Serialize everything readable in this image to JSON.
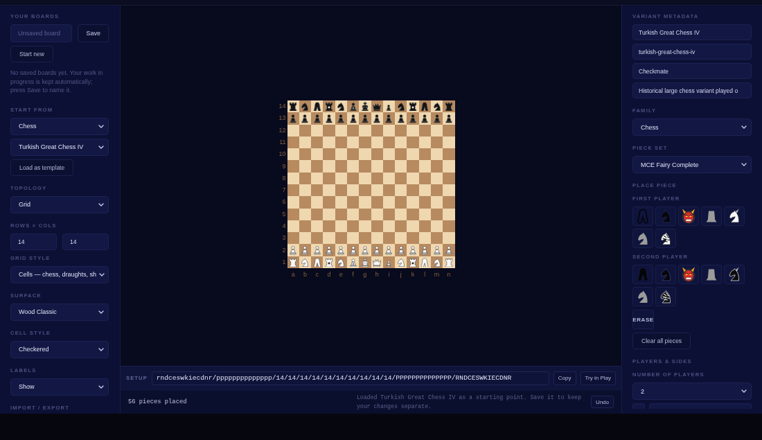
{
  "left_panel": {
    "sections": [
      {
        "heading": "YOUR BOARDS",
        "controls": [
          {
            "kind": "input_button_row",
            "placeholder": "Unsaved board",
            "button": "Save"
          },
          {
            "kind": "button",
            "label": "Start new"
          },
          {
            "kind": "note",
            "text": "No saved boards yet. Your work in progress is kept automatically; press Save to name it."
          }
        ]
      },
      {
        "heading": "START FROM",
        "controls": [
          {
            "kind": "select",
            "value": "Chess"
          },
          {
            "kind": "select",
            "value": "Turkish Great Chess IV"
          },
          {
            "kind": "button",
            "label": "Load as template"
          }
        ]
      },
      {
        "heading": "TOPOLOGY",
        "controls": [
          {
            "kind": "select",
            "value": "Grid"
          }
        ]
      },
      {
        "heading": "ROWS × COLS",
        "controls": [
          {
            "kind": "number_pair",
            "values": [
              "14",
              "14"
            ]
          }
        ]
      },
      {
        "heading": "GRID STYLE",
        "controls": [
          {
            "kind": "select",
            "value": "Cells — chess, draughts, sh"
          }
        ]
      },
      {
        "heading": "SURFACE",
        "controls": [
          {
            "kind": "select",
            "value": "Wood Classic"
          }
        ]
      },
      {
        "heading": "CELL STYLE",
        "controls": [
          {
            "kind": "select",
            "value": "Checkered"
          }
        ]
      },
      {
        "heading": "LABELS",
        "controls": [
          {
            "kind": "select",
            "value": "Show"
          }
        ]
      },
      {
        "heading": "IMPORT / EXPORT"
      }
    ]
  },
  "board": {
    "files": [
      "a",
      "b",
      "c",
      "d",
      "e",
      "f",
      "g",
      "h",
      "i",
      "j",
      "k",
      "l",
      "m",
      "n"
    ],
    "rows": [
      {
        "rank": "14",
        "black_pieces": true,
        "cells": [
          {
            "kind": "rook"
          },
          {
            "kind": "knight"
          },
          {
            "kind": "twin"
          },
          {
            "kind": "badgedrook"
          },
          {
            "kind": "knight"
          },
          {
            "kind": "badgedpawn"
          },
          {
            "kind": "king"
          },
          {
            "kind": "crown"
          },
          {
            "kind": "smallpawn"
          },
          {
            "kind": "knight"
          },
          {
            "kind": "badgedrook"
          },
          {
            "kind": "twin"
          },
          {
            "kind": "knight"
          },
          {
            "kind": "rook"
          }
        ]
      },
      {
        "rank": "13",
        "black_pieces": true,
        "cells": [
          {
            "kind": "pawn"
          },
          {
            "kind": "pawn"
          },
          {
            "kind": "pawn"
          },
          {
            "kind": "pawn"
          },
          {
            "kind": "pawn"
          },
          {
            "kind": "pawn"
          },
          {
            "kind": "pawn"
          },
          {
            "kind": "pawn"
          },
          {
            "kind": "pawn"
          },
          {
            "kind": "pawn"
          },
          {
            "kind": "pawn"
          },
          {
            "kind": "pawn"
          },
          {
            "kind": "pawn"
          },
          {
            "kind": "pawn"
          }
        ]
      },
      {
        "rank": "12",
        "cells": [
          null,
          null,
          null,
          null,
          null,
          null,
          null,
          null,
          null,
          null,
          null,
          null,
          null,
          null
        ]
      },
      {
        "rank": "11",
        "cells": [
          null,
          null,
          null,
          null,
          null,
          null,
          null,
          null,
          null,
          null,
          null,
          null,
          null,
          null
        ]
      },
      {
        "rank": "10",
        "cells": [
          null,
          null,
          null,
          null,
          null,
          null,
          null,
          null,
          null,
          null,
          null,
          null,
          null,
          null
        ]
      },
      {
        "rank": "9",
        "cells": [
          null,
          null,
          null,
          null,
          null,
          null,
          null,
          null,
          null,
          null,
          null,
          null,
          null,
          null
        ]
      },
      {
        "rank": "8",
        "cells": [
          null,
          null,
          null,
          null,
          null,
          null,
          null,
          null,
          null,
          null,
          null,
          null,
          null,
          null
        ]
      },
      {
        "rank": "7",
        "cells": [
          null,
          null,
          null,
          null,
          null,
          null,
          null,
          null,
          null,
          null,
          null,
          null,
          null,
          null
        ]
      },
      {
        "rank": "6",
        "cells": [
          null,
          null,
          null,
          null,
          null,
          null,
          null,
          null,
          null,
          null,
          null,
          null,
          null,
          null
        ]
      },
      {
        "rank": "5",
        "cells": [
          null,
          null,
          null,
          null,
          null,
          null,
          null,
          null,
          null,
          null,
          null,
          null,
          null,
          null
        ]
      },
      {
        "rank": "4",
        "cells": [
          null,
          null,
          null,
          null,
          null,
          null,
          null,
          null,
          null,
          null,
          null,
          null,
          null,
          null
        ]
      },
      {
        "rank": "3",
        "cells": [
          null,
          null,
          null,
          null,
          null,
          null,
          null,
          null,
          null,
          null,
          null,
          null,
          null,
          null
        ]
      },
      {
        "rank": "2",
        "black_pieces": false,
        "cells": [
          {
            "kind": "pawn"
          },
          {
            "kind": "pawn"
          },
          {
            "kind": "pawn"
          },
          {
            "kind": "pawn"
          },
          {
            "kind": "pawn"
          },
          {
            "kind": "pawn"
          },
          {
            "kind": "pawn"
          },
          {
            "kind": "pawn"
          },
          {
            "kind": "pawn"
          },
          {
            "kind": "pawn"
          },
          {
            "kind": "pawn"
          },
          {
            "kind": "pawn"
          },
          {
            "kind": "pawn"
          },
          {
            "kind": "pawn"
          }
        ]
      },
      {
        "rank": "1",
        "black_pieces": false,
        "cells": [
          {
            "kind": "rook"
          },
          {
            "kind": "knight"
          },
          {
            "kind": "twin"
          },
          {
            "kind": "badgedrook"
          },
          {
            "kind": "knight"
          },
          {
            "kind": "badgedpawn"
          },
          {
            "kind": "king"
          },
          {
            "kind": "crown"
          },
          {
            "kind": "smallpawn"
          },
          {
            "kind": "knight"
          },
          {
            "kind": "badgedrook"
          },
          {
            "kind": "twin"
          },
          {
            "kind": "knight"
          },
          {
            "kind": "rook"
          }
        ]
      }
    ]
  },
  "setup_bar": {
    "label": "SETUP",
    "value": "rndceswkiecdnr/pppppppppppppp/14/14/14/14/14/14/14/14/14/14/PPPPPPPPPPPPPP/RNDCESWKIECDNR",
    "buttons": [
      "Copy",
      "Try in Play"
    ]
  },
  "status_bar": {
    "count": "56 pieces placed",
    "message": "Loaded Turkish Great Chess IV as a starting point. Save it to keep your changes separate.",
    "button": "Undo"
  },
  "right_panel": {
    "sections": [
      {
        "heading": "VARIANT METADATA",
        "controls": [
          {
            "kind": "input",
            "value": "Turkish Great Chess IV"
          },
          {
            "kind": "input",
            "value": "turkish-great-chess-iv"
          },
          {
            "kind": "input",
            "value": "Checkmate"
          },
          {
            "kind": "input",
            "value": "Historical large chess variant played o"
          }
        ]
      },
      {
        "heading": "FAMILY",
        "controls": [
          {
            "kind": "select",
            "value": "Chess"
          }
        ]
      },
      {
        "heading": "PIECE SET",
        "controls": [
          {
            "kind": "select",
            "value": "MCE Fairy Complete"
          }
        ]
      },
      {
        "heading": "PLACE PIECE",
        "controls": [
          {
            "kind": "subheading",
            "text": "FIRST PLAYER"
          },
          {
            "kind": "palette",
            "black_pieces": false,
            "pieces": [
              {
                "kind": "twin"
              },
              {
                "kind": "knight"
              },
              {
                "kind": "ogre"
              },
              {
                "kind": "tower"
              },
              {
                "kind": "unicorn"
              },
              {
                "kind": "horsehead"
              },
              {
                "kind": "zebra"
              }
            ]
          },
          {
            "kind": "subheading",
            "text": "SECOND PLAYER"
          },
          {
            "kind": "palette",
            "black_pieces": true,
            "pieces": [
              {
                "kind": "twin"
              },
              {
                "kind": "knight"
              },
              {
                "kind": "ogre"
              },
              {
                "kind": "tower"
              },
              {
                "kind": "unicorn"
              },
              {
                "kind": "horsehead"
              },
              {
                "kind": "zebra"
              }
            ]
          },
          {
            "kind": "tile_button",
            "label": "ERASE"
          },
          {
            "kind": "button",
            "label": "Clear all pieces"
          }
        ]
      },
      {
        "heading": "PLAYERS & SIDES",
        "controls": [
          {
            "kind": "subheading",
            "text": "NUMBER OF PLAYERS"
          },
          {
            "kind": "select",
            "value": "2"
          },
          {
            "kind": "cut_fields"
          }
        ]
      }
    ]
  }
}
